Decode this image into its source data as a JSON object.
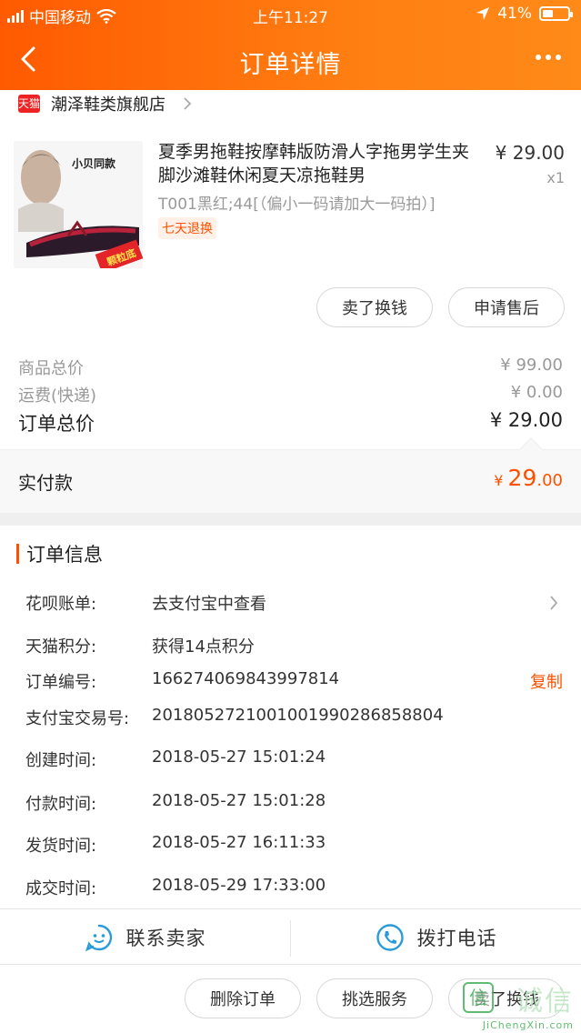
{
  "status_bar": {
    "carrier": "中国移动",
    "time": "上午11:27",
    "battery": "41%"
  },
  "nav": {
    "title": "订单详情"
  },
  "shop": {
    "badge": "天猫",
    "name": "潮泽鞋类旗舰店"
  },
  "product": {
    "title": "夏季男拖鞋按摩韩版防滑人字拖男学生夹脚沙滩鞋休闲夏天凉拖鞋男",
    "price": "¥ 29.00",
    "qty": "x1",
    "sku": "T001黑红;44[（偏小一码请加大一码拍）]",
    "tag": "七天退换",
    "image_text": {
      "top": "小贝同款",
      "bottom": "颗粒底"
    }
  },
  "product_actions": {
    "sell": "卖了换钱",
    "after_sale": "申请售后"
  },
  "totals": {
    "goods_label": "商品总价",
    "goods_value": "¥ 99.00",
    "shipping_label": "运费(快递)",
    "shipping_value": "¥ 0.00",
    "order_label": "订单总价",
    "order_value": "¥ 29.00"
  },
  "paid": {
    "label": "实付款",
    "symbol": "¥ ",
    "int": "29",
    "dec": ".00"
  },
  "order_info": {
    "title": "订单信息",
    "rows": [
      {
        "key": "花呗账单:",
        "value": "去支付宝中查看"
      },
      {
        "key": "天猫积分:",
        "value": "获得14点积分"
      },
      {
        "key": "订单编号:",
        "value": "166274069843997814",
        "action": "复制"
      },
      {
        "key": "支付宝交易号:",
        "value": "2018052721001001990286858804"
      },
      {
        "key": "创建时间:",
        "value": "2018-05-27 15:01:24"
      },
      {
        "key": "付款时间:",
        "value": "2018-05-27 15:01:28"
      },
      {
        "key": "发货时间:",
        "value": "2018-05-27 16:11:33"
      },
      {
        "key": "成交时间:",
        "value": "2018-05-29 17:33:00"
      }
    ]
  },
  "contact": {
    "seller": "联系卖家",
    "phone": "拨打电话"
  },
  "bottom_actions": {
    "delete": "删除订单",
    "pick": "挑选服务",
    "sell": "卖了换钱"
  },
  "watermark": {
    "cn": "诚信",
    "en": "JiChengXin.com"
  },
  "colors": {
    "accent": "#ff5000",
    "header_start": "#ff5a00",
    "header_end": "#ff8a18",
    "icon_blue": "#2a9bd8"
  }
}
